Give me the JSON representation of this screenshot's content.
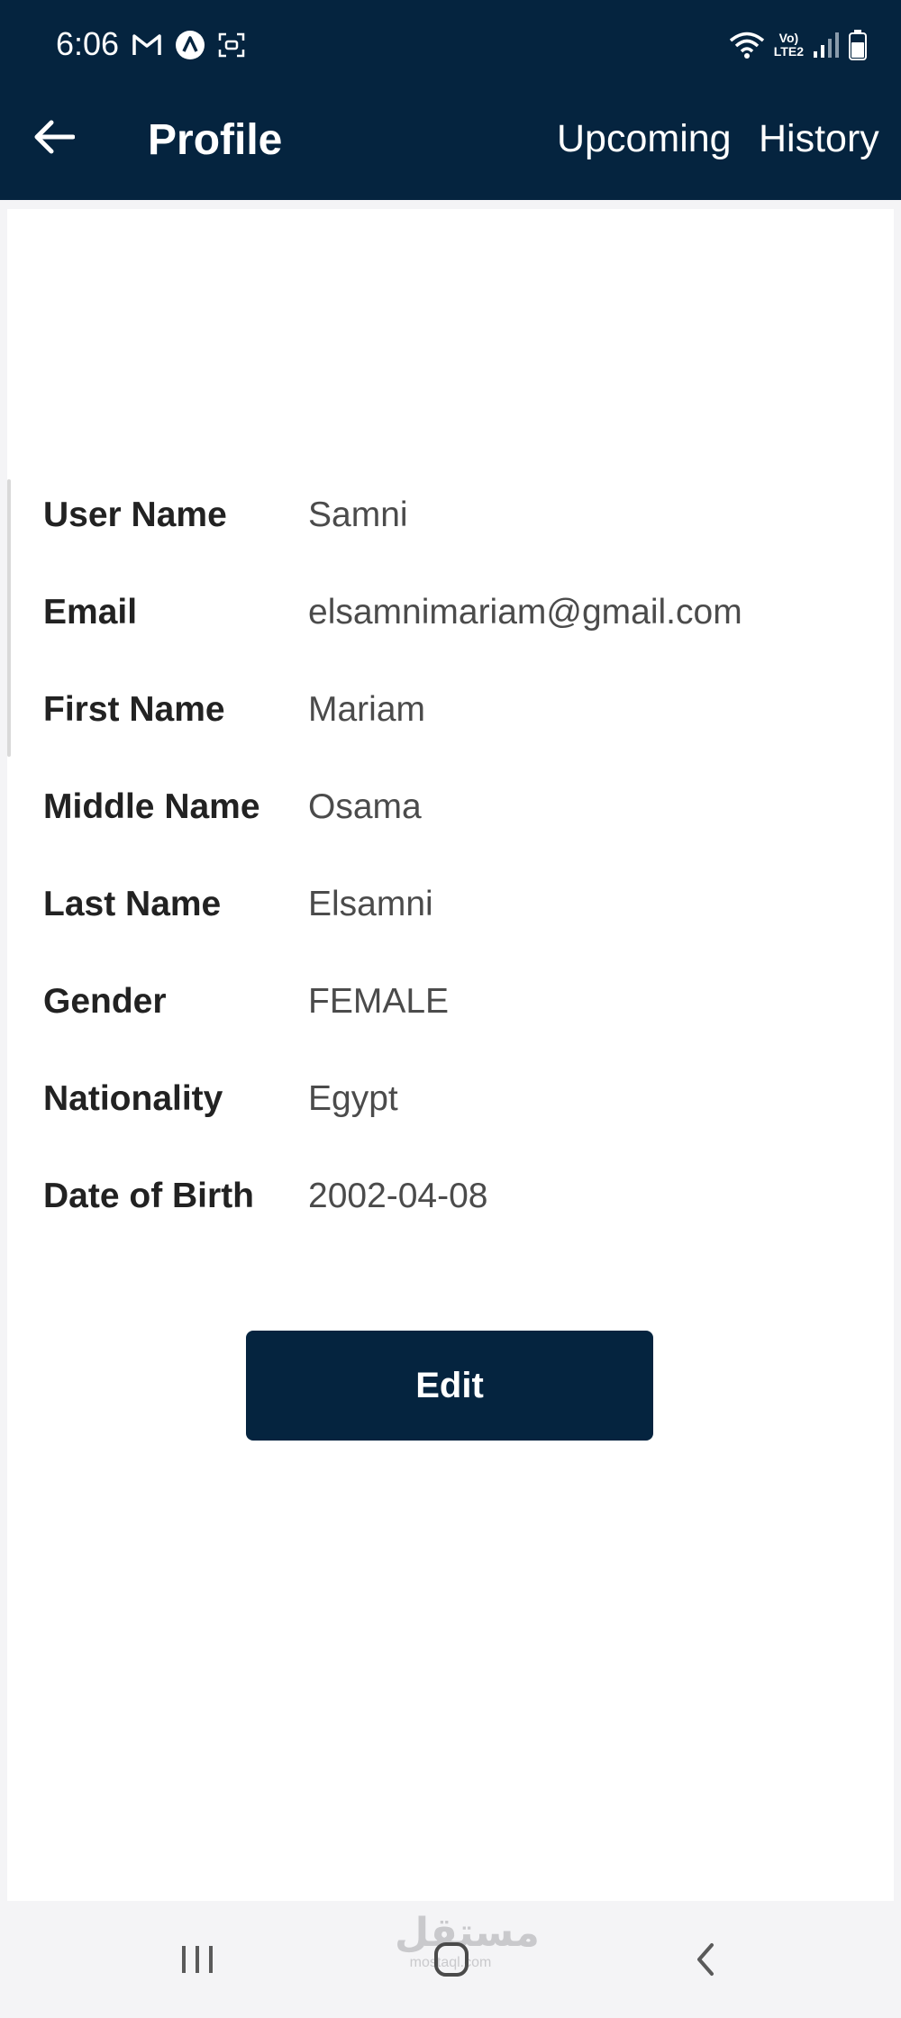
{
  "status_bar": {
    "time": "6:06",
    "network_label_top": "Vo)",
    "network_label_bottom": "LTE2"
  },
  "toolbar": {
    "back_icon": "arrow-left-icon",
    "title": "Profile",
    "upcoming_label": "Upcoming",
    "history_label": "History"
  },
  "profile": {
    "fields": [
      {
        "label": "User Name",
        "value": "Samni"
      },
      {
        "label": "Email",
        "value": "elsamnimariam@gmail.com"
      },
      {
        "label": "First Name",
        "value": "Mariam"
      },
      {
        "label": "Middle Name",
        "value": "Osama"
      },
      {
        "label": "Last Name",
        "value": "Elsamni"
      },
      {
        "label": "Gender",
        "value": "FEMALE"
      },
      {
        "label": "Nationality",
        "value": "Egypt"
      },
      {
        "label": "Date of Birth",
        "value": "2002-04-08"
      }
    ],
    "edit_label": "Edit"
  },
  "watermark": {
    "text": "مستقل",
    "sub": "mostaql.com"
  },
  "colors": {
    "primary": "#05243f",
    "background": "#ffffff",
    "label_text": "#222222",
    "value_text": "#4b4b4b"
  }
}
